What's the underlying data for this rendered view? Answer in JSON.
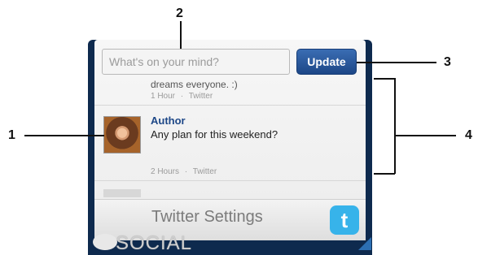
{
  "callouts": {
    "one": "1",
    "two": "2",
    "three": "3",
    "four": "4"
  },
  "status": {
    "placeholder": "What's on your mind?",
    "update_label": "Update"
  },
  "feed": {
    "items": [
      {
        "text": "dreams everyone. :)",
        "time": "1 Hour",
        "separator": "·",
        "source": "Twitter"
      },
      {
        "author": "Author",
        "text": "Any plan for this weekend?",
        "time": "2 Hours",
        "separator": "·",
        "source": "Twitter"
      }
    ]
  },
  "bottom": {
    "settings_label": "Twitter Settings",
    "twitter_icon_letter": "t",
    "social_label": "SOCIAL"
  },
  "colors": {
    "accent": "#1d4787",
    "twitter": "#37b3ea",
    "frame": "#0e2a4e"
  }
}
